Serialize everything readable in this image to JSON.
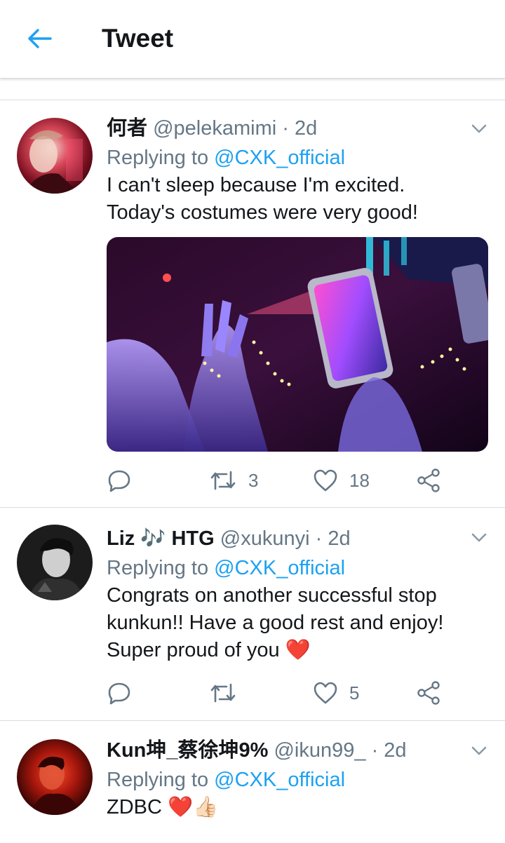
{
  "header": {
    "title": "Tweet"
  },
  "tweets": [
    {
      "display_name": "何者",
      "handle": "@pelekamimi",
      "time": "· 2d",
      "replying_prefix": "Replying to ",
      "replying_to": "@CXK_official",
      "text_lines": [
        "I can't sleep because I'm excited.",
        "Today's costumes were very good!"
      ],
      "retweets": "3",
      "likes": "18"
    },
    {
      "display_name": "Liz 🎶 HTG",
      "handle": "@xukunyi",
      "time": "· 2d",
      "replying_prefix": "Replying to ",
      "replying_to": "@CXK_official",
      "text_lines": [
        "Congrats on another successful stop",
        "kunkun!! Have a good rest and enjoy!",
        "Super proud of you ❤️"
      ],
      "retweets": "",
      "likes": "5"
    },
    {
      "display_name": "Kun坤_蔡徐坤9%",
      "handle": "@ikun99_",
      "time": "· 2d",
      "replying_prefix": "Replying to ",
      "replying_to": "@CXK_official",
      "text_lines": [
        "ZDBC ❤️👍🏻"
      ]
    }
  ],
  "colors": {
    "accent": "#1da1f2",
    "muted": "#657786",
    "text": "#14171a",
    "divider": "#d8dde1"
  },
  "icons": [
    "back-arrow-icon",
    "chevron-down-icon",
    "reply-icon",
    "retweet-icon",
    "like-icon",
    "share-icon"
  ]
}
